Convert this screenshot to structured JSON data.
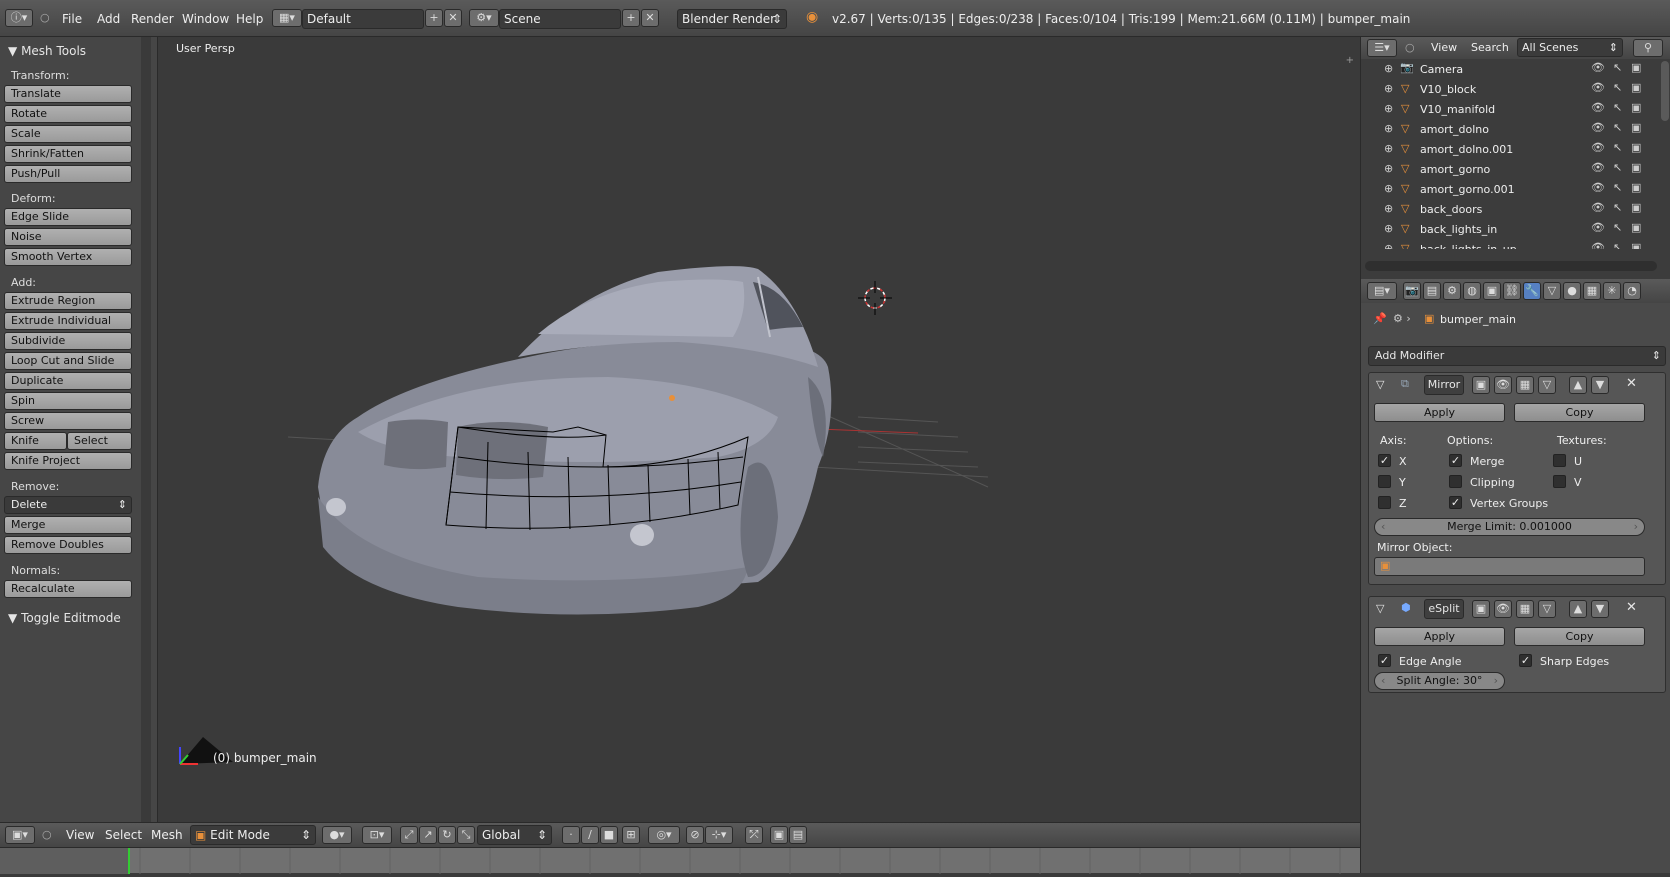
{
  "topbar": {
    "menus": [
      "File",
      "Add",
      "Render",
      "Window",
      "Help"
    ],
    "layout": "Default",
    "scene": "Scene",
    "engine": "Blender Render",
    "stats": "v2.67 | Verts:0/135 | Edges:0/238 | Faces:0/104 | Tris:199 | Mem:21.66M (0.11M) | bumper_main"
  },
  "tools": {
    "title": "Mesh Tools",
    "transform_label": "Transform:",
    "transform": [
      "Translate",
      "Rotate",
      "Scale",
      "Shrink/Fatten",
      "Push/Pull"
    ],
    "deform_label": "Deform:",
    "deform": [
      "Edge Slide",
      "Noise",
      "Smooth Vertex"
    ],
    "add_label": "Add:",
    "add": [
      "Extrude Region",
      "Extrude Individual",
      "Subdivide",
      "Loop Cut and Slide",
      "Duplicate",
      "Spin",
      "Screw"
    ],
    "knife": "Knife",
    "select": "Select",
    "knife_project": "Knife Project",
    "remove_label": "Remove:",
    "delete": "Delete",
    "merge": "Merge",
    "remove_doubles": "Remove Doubles",
    "normals_label": "Normals:",
    "recalculate": "Recalculate",
    "toggle_editmode": "Toggle Editmode"
  },
  "viewport": {
    "view_name": "User Persp",
    "object_label": "(0) bumper_main"
  },
  "vpheader": {
    "menus": [
      "View",
      "Select",
      "Mesh"
    ],
    "mode": "Edit Mode",
    "orientation": "Global"
  },
  "outliner": {
    "view": "View",
    "search": "Search",
    "scenes": "All Scenes",
    "items": [
      "Camera",
      "V10_block",
      "V10_manifold",
      "amort_dolno",
      "amort_dolno.001",
      "amort_gorno",
      "amort_gorno.001",
      "back_doors",
      "back_lights_in",
      "back_lights_in_up"
    ]
  },
  "props": {
    "object": "bumper_main",
    "add_modifier": "Add Modifier",
    "mirror": {
      "name": "Mirror",
      "apply": "Apply",
      "copy": "Copy",
      "axis_label": "Axis:",
      "options_label": "Options:",
      "textures_label": "Textures:",
      "x": "X",
      "y": "Y",
      "z": "Z",
      "merge": "Merge",
      "clipping": "Clipping",
      "vertex_groups": "Vertex Groups",
      "u": "U",
      "v": "V",
      "merge_limit": "Merge Limit: 0.001000",
      "mirror_object": "Mirror Object:"
    },
    "esplit": {
      "name": "eSplit",
      "apply": "Apply",
      "copy": "Copy",
      "edge_angle": "Edge Angle",
      "sharp_edges": "Sharp Edges",
      "split_angle": "Split Angle: 30°"
    }
  }
}
